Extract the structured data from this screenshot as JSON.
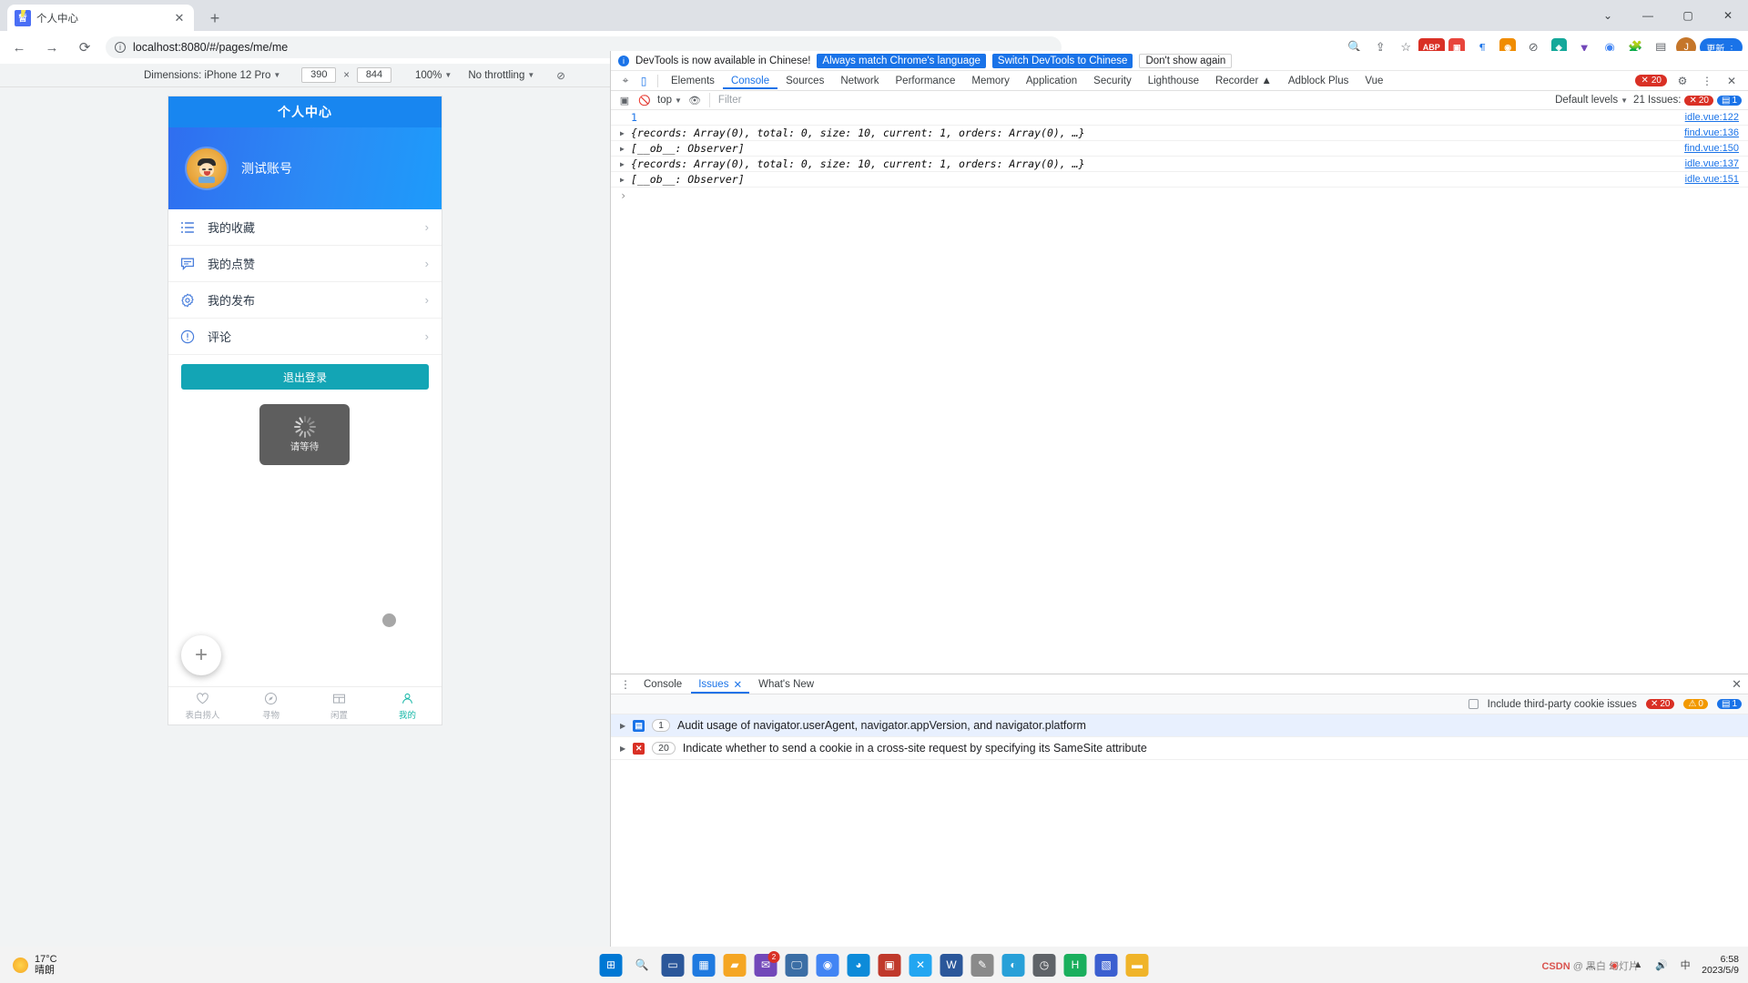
{
  "browser": {
    "tab_title": "个人中心",
    "tab_close": "✕",
    "new_tab": "+",
    "url": "localhost:8080/#/pages/me/me",
    "info_icon": "ⓘ",
    "back": "←",
    "forward": "→",
    "reload": "⟳",
    "window_minimize": "—",
    "window_maximize": "▢",
    "window_close": "✕",
    "window_chevron": "⌄",
    "profile_initial": "J",
    "update_pill": "更新 ⋮"
  },
  "device_bar": {
    "dimensions_label": "Dimensions: iPhone 12 Pro",
    "width": "390",
    "height": "844",
    "separator": "×",
    "zoom": "100%",
    "throttling": "No throttling",
    "rotate_icon": "⊘"
  },
  "app": {
    "header_title": "个人中心",
    "username": "测试账号",
    "menu": [
      {
        "icon": "list-icon",
        "label": "我的收藏",
        "arrow": "›"
      },
      {
        "icon": "comment-icon",
        "label": "我的点赞",
        "arrow": "›"
      },
      {
        "icon": "gear-icon",
        "label": "我的发布",
        "arrow": "›"
      },
      {
        "icon": "exclamation-icon",
        "label": "评论",
        "arrow": "›"
      }
    ],
    "logout_label": "退出登录",
    "loading_text": "请等待",
    "fab_label": "+",
    "tabbar": [
      {
        "icon": "heart-icon",
        "label": "表白捞人",
        "active": false
      },
      {
        "icon": "compass-icon",
        "label": "寻物",
        "active": false
      },
      {
        "icon": "box-icon",
        "label": "闲置",
        "active": false
      },
      {
        "icon": "person-icon",
        "label": "我的",
        "active": true
      }
    ]
  },
  "devtools": {
    "banner": {
      "message": "DevTools is now available in Chinese!",
      "btn_match": "Always match Chrome's language",
      "btn_switch": "Switch DevTools to Chinese",
      "btn_dismiss": "Don't show again"
    },
    "tabs": [
      "Elements",
      "Console",
      "Sources",
      "Network",
      "Performance",
      "Memory",
      "Application",
      "Security",
      "Lighthouse",
      "Recorder",
      "Adblock Plus",
      "Vue"
    ],
    "active_tab": "Console",
    "recorder_suffix": "▲",
    "error_badge": "20",
    "settings_icon": "⚙",
    "more_icon": "⋮",
    "close_icon": "✕",
    "filterbar": {
      "context": "top",
      "filter_placeholder": "Filter",
      "levels": "Default levels",
      "issues_label": "21 Issues:",
      "issues_error": "20",
      "issues_info": "1"
    },
    "logs": [
      {
        "arrow": "",
        "text": "1",
        "plain_number": true,
        "source": "idle.vue:122"
      },
      {
        "arrow": "▶",
        "text": "{records: Array(0), total: 0, size: 10, current: 1, orders: Array(0), …}",
        "source": "find.vue:136"
      },
      {
        "arrow": "▶",
        "text": "[__ob__: Observer]",
        "source": "find.vue:150"
      },
      {
        "arrow": "▶",
        "text": "{records: Array(0), total: 0, size: 10, current: 1, orders: Array(0), …}",
        "source": "idle.vue:137"
      },
      {
        "arrow": "▶",
        "text": "[__ob__: Observer]",
        "source": "idle.vue:151"
      }
    ],
    "prompt": "›",
    "drawer": {
      "tabs": [
        "Console",
        "Issues",
        "What's New"
      ],
      "active_tab": "Issues",
      "issues_close": "✕",
      "checkbox_label": "Include third-party cookie issues",
      "badge_error": "20",
      "badge_warn": "0",
      "badge_info": "1",
      "rows": [
        {
          "arrow": "▶",
          "kind": "info",
          "kind_glyph": "▤",
          "count": "1",
          "text": "Audit usage of navigator.userAgent, navigator.appVersion, and navigator.platform",
          "selected": true
        },
        {
          "arrow": "▶",
          "kind": "error",
          "kind_glyph": "✕",
          "count": "20",
          "text": "Indicate whether to send a cookie in a cross-site request by specifying its SameSite attribute",
          "selected": false
        }
      ]
    }
  },
  "taskbar": {
    "temperature": "17°C",
    "condition": "晴朗",
    "chevron_up": "︿",
    "time": "6:58",
    "date": "2023/5/9",
    "watermark_prefix": "CSDN",
    "watermark_text": "@ 黑白 幻灯片",
    "icons": [
      {
        "name": "start-icon",
        "glyph": "⊞",
        "color": "#0078d4",
        "badge": ""
      },
      {
        "name": "search-icon",
        "glyph": "🔍",
        "color": "transparent",
        "badge": ""
      },
      {
        "name": "taskview-icon",
        "glyph": "▭",
        "color": "#2b579a",
        "badge": ""
      },
      {
        "name": "widgets-icon",
        "glyph": "▦",
        "color": "#1f7ae0",
        "badge": ""
      },
      {
        "name": "folder-icon",
        "glyph": "▰",
        "color": "#f5a623",
        "badge": ""
      },
      {
        "name": "mail-icon",
        "glyph": "✉",
        "color": "#7248b9",
        "badge": "2"
      },
      {
        "name": "monitor-icon",
        "glyph": "🖵",
        "color": "#3b6ea5",
        "badge": ""
      },
      {
        "name": "chrome-icon",
        "glyph": "◉",
        "color": "#4285f4",
        "badge": ""
      },
      {
        "name": "edge-icon",
        "glyph": "◕",
        "color": "#0d8bd9",
        "badge": ""
      },
      {
        "name": "store-icon",
        "glyph": "▣",
        "color": "#c0392b",
        "badge": ""
      },
      {
        "name": "code-icon",
        "glyph": "✕",
        "color": "#22a6f1",
        "badge": ""
      },
      {
        "name": "word-icon",
        "glyph": "W",
        "color": "#2b579a",
        "badge": ""
      },
      {
        "name": "sketch-icon",
        "glyph": "✎",
        "color": "#8a8a8a",
        "badge": ""
      },
      {
        "name": "paint-icon",
        "glyph": "◐",
        "color": "#28a0d8",
        "badge": ""
      },
      {
        "name": "clock-icon",
        "glyph": "◷",
        "color": "#5f6368",
        "badge": ""
      },
      {
        "name": "hbuilder-icon",
        "glyph": "H",
        "color": "#1aaf5d",
        "badge": ""
      },
      {
        "name": "app-icon",
        "glyph": "▧",
        "color": "#3b5fd0",
        "badge": ""
      },
      {
        "name": "explorer-icon",
        "glyph": "▬",
        "color": "#f0b429",
        "badge": ""
      }
    ]
  }
}
